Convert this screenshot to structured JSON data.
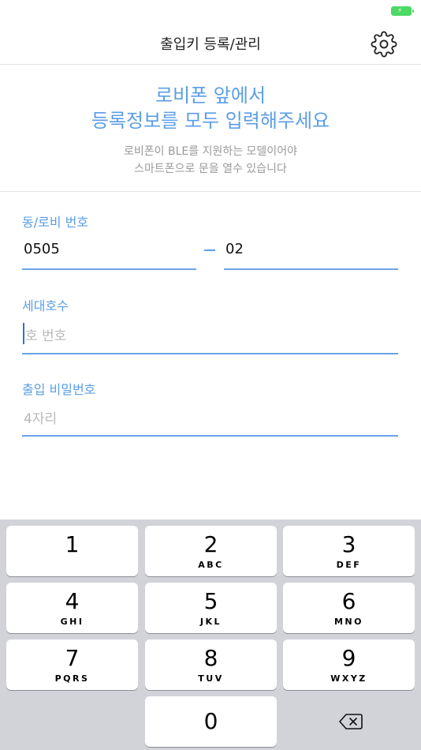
{
  "nav": {
    "title": "출입키 등록/관리"
  },
  "intro": {
    "title_line1": "로비폰 앞에서",
    "title_line2": "등록정보를 모두 입력해주세요",
    "sub_line1": "로비폰이 BLE를 지원하는 모델이어야",
    "sub_line2": "스마트폰으로 문을 열수 있습니다"
  },
  "form": {
    "lobby": {
      "label": "동/로비 번호",
      "building": "0505",
      "lobby": "02"
    },
    "unit": {
      "label": "세대호수",
      "placeholder": "호 번호"
    },
    "password": {
      "label": "출입 비밀번호",
      "placeholder": "4자리"
    }
  },
  "keyboard": {
    "keys": [
      {
        "num": "1",
        "letters": ""
      },
      {
        "num": "2",
        "letters": "ABC"
      },
      {
        "num": "3",
        "letters": "DEF"
      },
      {
        "num": "4",
        "letters": "GHI"
      },
      {
        "num": "5",
        "letters": "JKL"
      },
      {
        "num": "6",
        "letters": "MNO"
      },
      {
        "num": "7",
        "letters": "PQRS"
      },
      {
        "num": "8",
        "letters": "TUV"
      },
      {
        "num": "9",
        "letters": "WXYZ"
      },
      {
        "num": "0",
        "letters": ""
      }
    ],
    "delete_icon": "backspace-icon"
  },
  "colors": {
    "accent": "#5b9ee6",
    "battery": "#4cd964",
    "keyboard_bg": "#d1d3d9"
  }
}
